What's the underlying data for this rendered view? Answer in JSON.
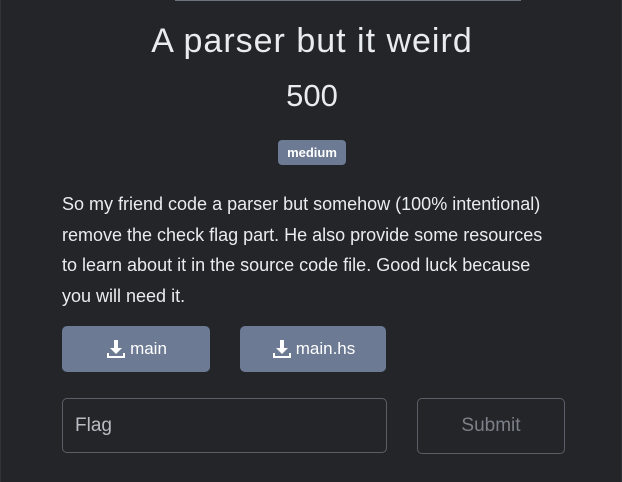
{
  "challenge": {
    "title": "A parser but it weird",
    "value": "500",
    "difficulty_badge": "medium",
    "description": "So my friend code a parser but somehow (100% intentional) remove the check flag part. He also provide some resources to learn about it in the source code file. Good luck because you will need it."
  },
  "files": [
    {
      "label": "main",
      "icon": "download-icon"
    },
    {
      "label": "main.hs",
      "icon": "download-icon"
    }
  ],
  "submission": {
    "flag_placeholder": "Flag",
    "flag_value": "",
    "submit_label": "Submit"
  },
  "colors": {
    "background": "#232529",
    "badge": "#6c7a93",
    "button": "#6c7a93",
    "text": "#e9ecef",
    "muted": "#7c8088"
  }
}
